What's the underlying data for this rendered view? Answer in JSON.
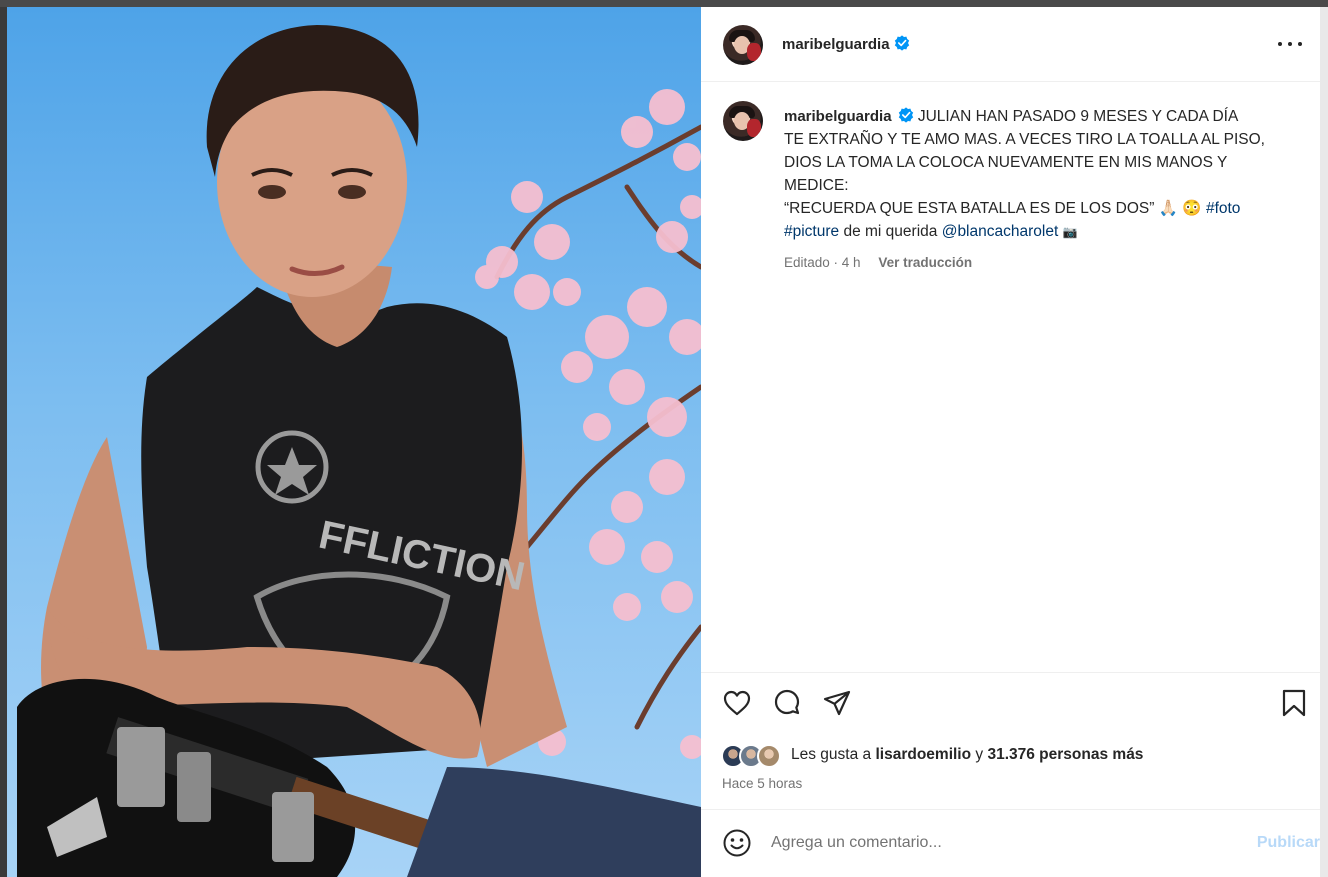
{
  "post": {
    "username": "maribelguardia",
    "caption_lines": [
      "JULIAN HAN PASADO 9 MESES Y CADA DÍA",
      "TE EXTRAÑO Y TE AMO MAS. A VECES TIRO LA TOALLA AL PISO,",
      "DIOS LA TOMA LA COLOCA NUEVAMENTE EN MIS MANOS Y",
      "MEDICE:",
      "“RECUERDA QUE ESTA BATALLA ES DE LOS DOS”"
    ],
    "emoji_1": "🙏🏻",
    "emoji_2": "😳",
    "hashtag_1": "#foto",
    "hashtag_2": "#picture",
    "caption_mid": "de mi querida",
    "mention": "@blancacharolet",
    "emoji_3": "📷",
    "edited_time": "Editado · 4 h",
    "translate_label": "Ver traducción",
    "likes_prefix": "Les gusta a",
    "liker_username": "lisardoemilio",
    "likes_joiner": "y",
    "likes_rest": "31.376 personas más",
    "post_time": "Hace 5 horas",
    "comment_placeholder": "Agrega un comentario...",
    "publish_label": "Publicar",
    "photo_shirt_text": "FFLICTION"
  },
  "icons": {
    "verified": "verified-badge-icon",
    "like": "heart-icon",
    "comment": "comment-bubble-icon",
    "share": "paper-plane-icon",
    "save": "bookmark-icon",
    "more": "more-options-icon",
    "emoji": "smiley-icon"
  },
  "colors": {
    "verified": "#0095f6",
    "link": "#00376b",
    "muted": "#737373",
    "publish_disabled": "#b8d9f8"
  }
}
